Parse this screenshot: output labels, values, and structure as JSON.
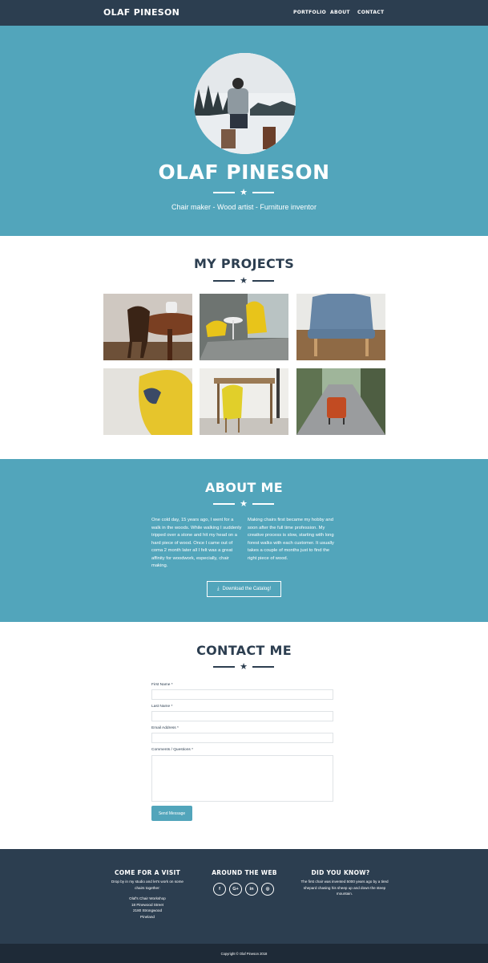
{
  "nav": {
    "brand": "OLAF PINESON",
    "links": [
      "PORTFOLIO",
      "ABOUT",
      "CONTACT"
    ]
  },
  "hero": {
    "title": "OLAF PINESON",
    "subtitle": "Chair maker - Wood artist - Furniture inventor"
  },
  "projects": {
    "title": "MY PROJECTS"
  },
  "about": {
    "title": "ABOUT ME",
    "col1": "One cold day, 15 years ago, I went for a walk in the woods. While walking I suddenly tripped over a stone and hit my head on a hard piece of wood. Once I came out of coma 2 month later all I felt was a great affinity for woodwork, especially, chair making.",
    "col2": "Making chairs first became my hobby and soon after the full time profession. My creative process is slow, starting with long forest walks with each customer. It usually takes a couple of months just to find the right piece of wood.",
    "button": "Download the Catalog!"
  },
  "contact": {
    "title": "CONTACT ME",
    "first_name": "First Name *",
    "last_name": "Last Name *",
    "email": "Email Address *",
    "comments": "Comments / Questions *",
    "send": "Send Message"
  },
  "footer": {
    "visit_title": "COME FOR A VISIT",
    "visit_text": "Drop by in my studio and let's work on some chairs together:",
    "address": [
      "Olaf's Chair Workshop",
      "18 Pinewood Street",
      "2180 Strongwood",
      "Pineland"
    ],
    "web_title": "AROUND THE WEB",
    "social": [
      "f",
      "G+",
      "in",
      "◎"
    ],
    "know_title": "DID YOU KNOW?",
    "know_text": "The first chair was invented 5000 years ago by a tired shepard chasing his sheep up and down the steep mountain.",
    "copyright": "Copyright © Olaf Pineson 2018"
  },
  "colors": {
    "primary": "#52a5bb",
    "dark": "#2c3e50",
    "darker": "#1e2a37"
  }
}
